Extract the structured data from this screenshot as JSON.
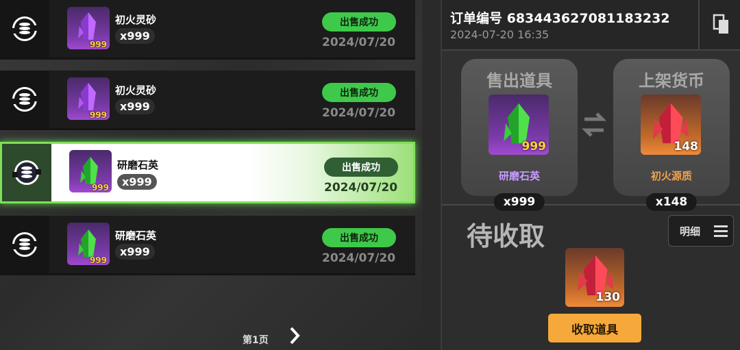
{
  "list": {
    "rows": [
      {
        "name": "初火灵砂",
        "count": "x999",
        "icon_qty": "999",
        "status": "出售成功",
        "date": "2024/07/20",
        "crystal": "purple"
      },
      {
        "name": "初火灵砂",
        "count": "x999",
        "icon_qty": "999",
        "status": "出售成功",
        "date": "2024/07/20",
        "crystal": "purple"
      },
      {
        "name": "研磨石英",
        "count": "x999",
        "icon_qty": "999",
        "status": "出售成功",
        "date": "2024/07/20",
        "crystal": "green"
      },
      {
        "name": "研磨石英",
        "count": "x999",
        "icon_qty": "999",
        "status": "出售成功",
        "date": "2024/07/20",
        "crystal": "green"
      }
    ],
    "page_label": "第1页"
  },
  "order": {
    "number": "订单编号 683443627081183232",
    "time": "2024-07-20 16:35"
  },
  "trade": {
    "sell": {
      "title": "售出道具",
      "name": "研磨石英",
      "count": "x999",
      "icon_qty": "999"
    },
    "price": {
      "title": "上架货币",
      "name": "初火源质",
      "count": "x148",
      "icon_qty": "148"
    }
  },
  "pending": {
    "label": "待收取",
    "detail_label": "明细",
    "reward_qty": "130",
    "claim_label": "收取道具"
  },
  "colors": {
    "status_green": "#3ec94b",
    "claim_orange": "#f6a93a",
    "purple_name": "#c79cff",
    "orange_name": "#f3a24a"
  }
}
